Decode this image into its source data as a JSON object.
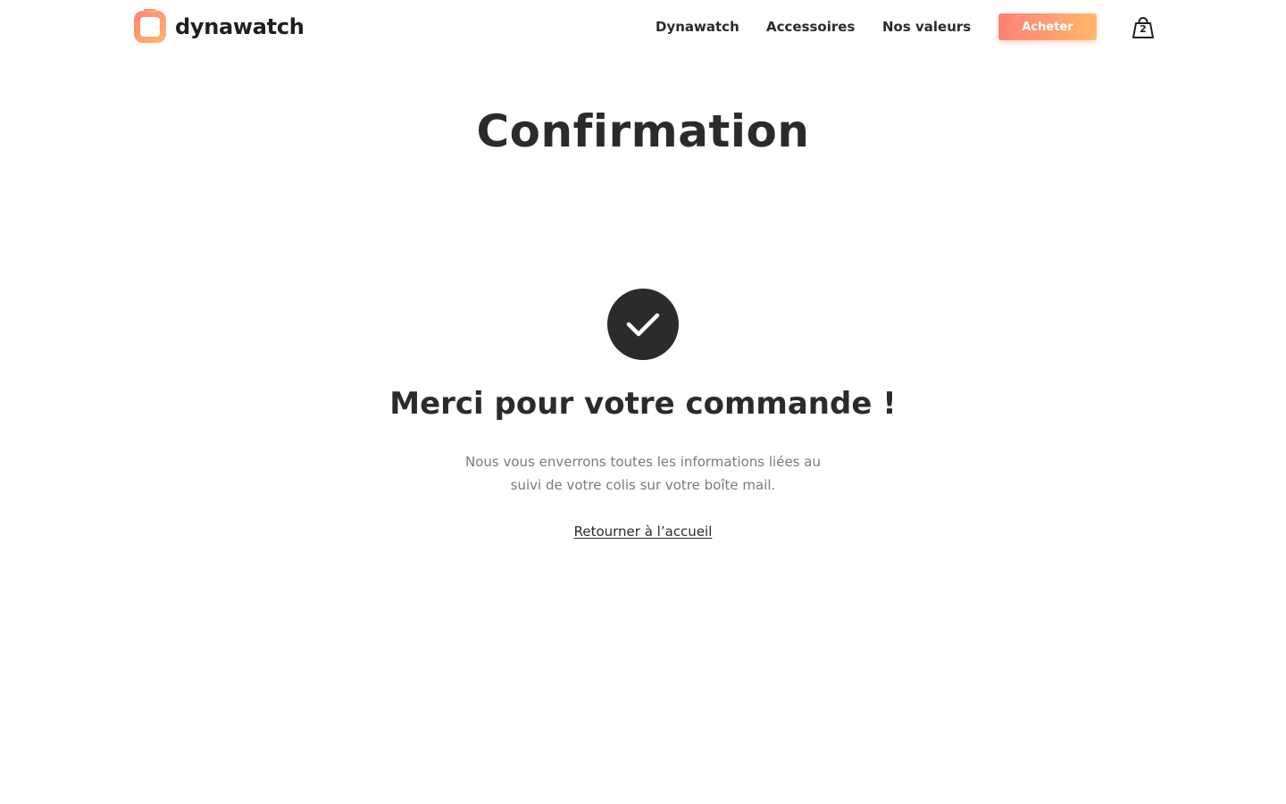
{
  "brand": {
    "name": "dynawatch",
    "gradient_start": "#ff8177",
    "gradient_end": "#ffb86a"
  },
  "nav": {
    "links": [
      "Dynawatch",
      "Accessoires",
      "Nos valeurs"
    ],
    "buy_label": "Acheter",
    "cart_count": "2",
    "cart_icon": "shopping-bag-icon"
  },
  "page": {
    "title": "Confirmation",
    "success_icon": "check-icon",
    "heading": "Merci pour votre commande !",
    "message_line1": "Nous vous enverrons toutes les informations liées au",
    "message_line2": "suivi de votre colis sur votre boîte mail.",
    "home_link": "Retourner à l’accueil"
  },
  "colors": {
    "text_dark": "#2b2b2b",
    "text_muted": "#7a7a7a",
    "background": "#ffffff"
  }
}
